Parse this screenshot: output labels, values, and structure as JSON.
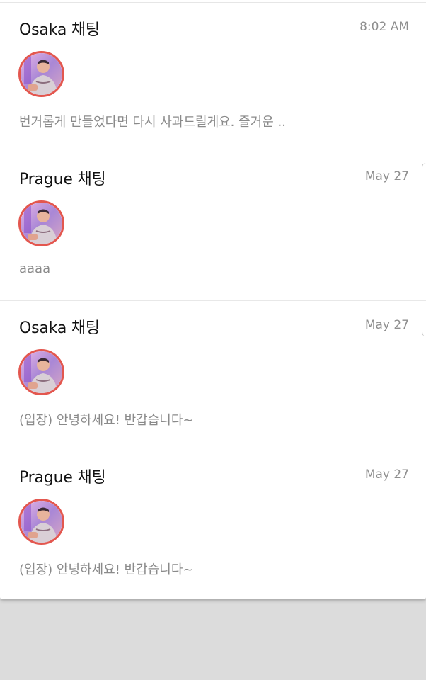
{
  "chats": [
    {
      "title": "Osaka 채팅",
      "time": "8:02 AM",
      "message": "번거롭게 만들었다면 다시 사과드릴게요. 즐거운 .."
    },
    {
      "title": "Prague 채팅",
      "time": "May 27",
      "message": "aaaa"
    },
    {
      "title": "Osaka 채팅",
      "time": "May 27",
      "message": "(입장) 안녕하세요! 반갑습니다~"
    },
    {
      "title": "Prague 채팅",
      "time": "May 27",
      "message": "(입장) 안녕하세요! 반갑습니다~"
    }
  ],
  "avatar": {
    "icon": "user-avatar-photo",
    "ring_color": "#e3574f"
  }
}
